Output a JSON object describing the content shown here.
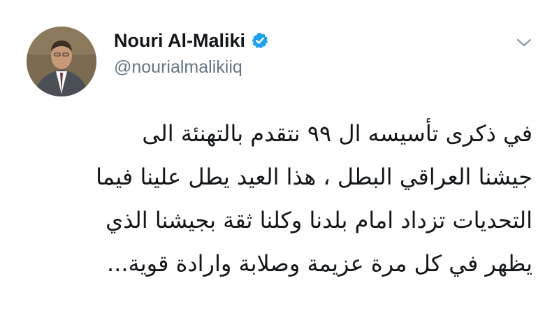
{
  "author": {
    "display_name": "Nouri Al-Maliki",
    "handle": "@nourialmalikiiq",
    "verified": true,
    "avatar_icon": "profile-photo"
  },
  "menu": {
    "icon": "chevron-down-icon"
  },
  "tweet": {
    "lines": [
      "في ذكرى تأسيسه ال ٩٩ نتقدم بالتهنئة الى",
      "جيشنا العراقي البطل ، هذا العيد يطل علينا فيما",
      "التحديات تزداد امام بلدنا وكلنا ثقة بجيشنا الذي",
      "يظهر في كل مرة عزيمة وصلابة وارادة قوية..."
    ]
  },
  "colors": {
    "text": "#14171a",
    "secondary": "#657786",
    "verified_blue": "#1da1f2"
  }
}
